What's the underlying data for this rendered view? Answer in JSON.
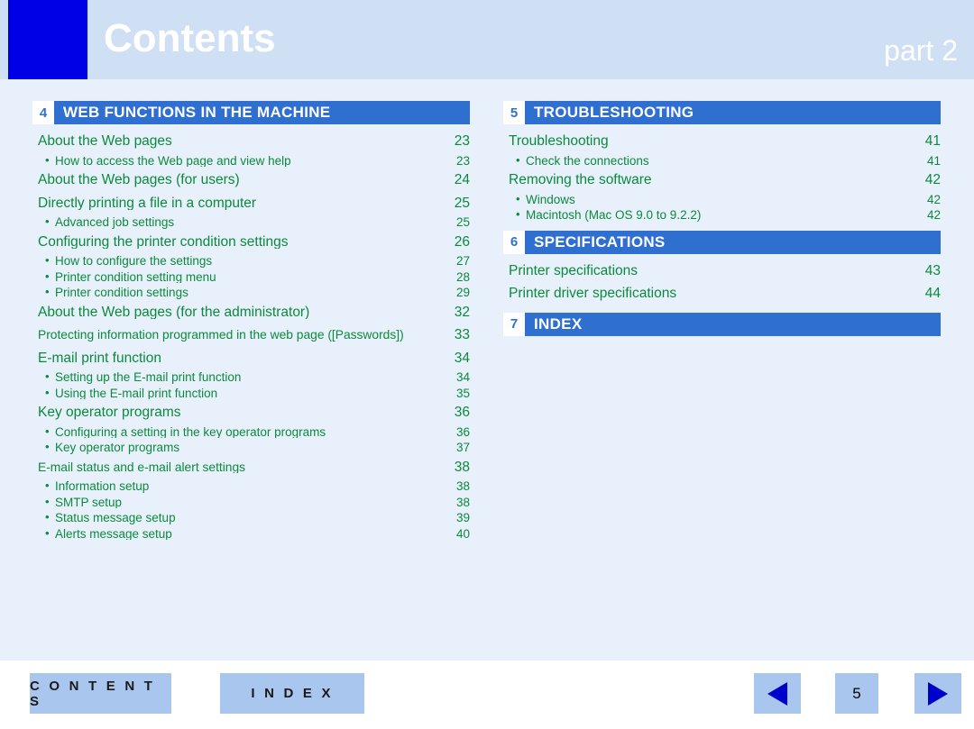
{
  "header": {
    "title": "Contents",
    "part_label": "part 2"
  },
  "sections": [
    {
      "number": "4",
      "title": "WEB FUNCTIONS IN THE MACHINE",
      "column": "left",
      "entries": [
        {
          "level": 1,
          "label": "About the Web pages",
          "page": "23"
        },
        {
          "level": 2,
          "label": "How to access the Web page and view help",
          "page": "23"
        },
        {
          "level": 1,
          "label": "About the Web pages (for users)",
          "page": "24"
        },
        {
          "level": 1,
          "label": "Directly printing a file in a computer",
          "page": "25"
        },
        {
          "level": 2,
          "label": "Advanced job settings",
          "page": "25"
        },
        {
          "level": 1,
          "label": "Configuring the printer condition settings",
          "page": "26"
        },
        {
          "level": 2,
          "label": "How to configure the settings",
          "page": "27"
        },
        {
          "level": 2,
          "label": "Printer condition setting menu",
          "page": "28"
        },
        {
          "level": 2,
          "label": "Printer condition settings",
          "page": "29"
        },
        {
          "level": 1,
          "label": "About the Web pages (for the administrator)",
          "page": "32"
        },
        {
          "level": 1,
          "label": "Protecting information programmed in the web page ([Passwords])",
          "page": "33",
          "narrow": true
        },
        {
          "level": 1,
          "label": "E-mail print function",
          "page": "34"
        },
        {
          "level": 2,
          "label": "Setting up the E-mail print function",
          "page": "34"
        },
        {
          "level": 2,
          "label": "Using the E-mail print function",
          "page": "35"
        },
        {
          "level": 1,
          "label": "Key operator programs",
          "page": "36"
        },
        {
          "level": 2,
          "label": "Configuring a setting in the key operator programs",
          "page": "36"
        },
        {
          "level": 2,
          "label": "Key operator programs",
          "page": "37"
        },
        {
          "level": 1,
          "label": "E-mail status and e-mail alert settings",
          "page": "38",
          "narrow": true
        },
        {
          "level": 2,
          "label": "Information setup",
          "page": "38"
        },
        {
          "level": 2,
          "label": "SMTP setup",
          "page": "38"
        },
        {
          "level": 2,
          "label": "Status message setup",
          "page": "39"
        },
        {
          "level": 2,
          "label": "Alerts message setup",
          "page": "40"
        }
      ]
    },
    {
      "number": "5",
      "title": "TROUBLESHOOTING",
      "column": "right",
      "entries": [
        {
          "level": 1,
          "label": "Troubleshooting",
          "page": "41"
        },
        {
          "level": 2,
          "label": "Check the connections",
          "page": "41"
        },
        {
          "level": 1,
          "label": "Removing the software",
          "page": "42"
        },
        {
          "level": 2,
          "label": "Windows",
          "page": "42"
        },
        {
          "level": 2,
          "label": "Macintosh (Mac OS 9.0 to 9.2.2)",
          "page": "42"
        }
      ]
    },
    {
      "number": "6",
      "title": "SPECIFICATIONS",
      "column": "right",
      "entries": [
        {
          "level": 1,
          "label": "Printer specifications",
          "page": "43"
        },
        {
          "level": 1,
          "label": "Printer driver specifications",
          "page": "44"
        }
      ]
    },
    {
      "number": "7",
      "title": "INDEX",
      "column": "right",
      "entries": []
    }
  ],
  "footer": {
    "contents_label": "C O N T E N T S",
    "index_label": "I N D E X",
    "page_number": "5",
    "prev_icon": "triangle-left-icon",
    "next_icon": "triangle-right-icon"
  }
}
